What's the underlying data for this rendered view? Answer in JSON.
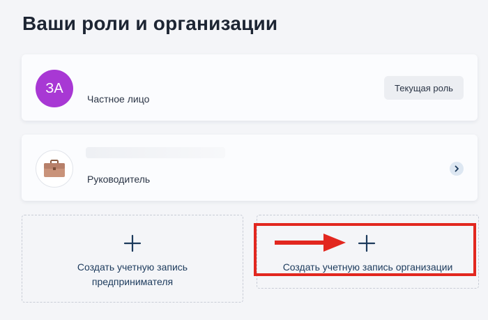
{
  "page": {
    "title": "Ваши роли и организации"
  },
  "roles": [
    {
      "avatar_initials": "ЗА",
      "avatar_color": "#a838d4",
      "label": "Частное лицо",
      "action": "Текущая роль"
    },
    {
      "avatar_icon": "briefcase-icon",
      "label": "Руководитель",
      "action_icon": "chevron-right-icon"
    }
  ],
  "create": {
    "entrepreneur": {
      "label": "Создать учетную запись\nпредпринимателя",
      "icon": "plus-icon"
    },
    "organization": {
      "label": "Создать учетную запись организации",
      "icon": "plus-icon"
    }
  },
  "annotation": {
    "color": "#e2271f",
    "icon": "arrow-right-icon"
  }
}
